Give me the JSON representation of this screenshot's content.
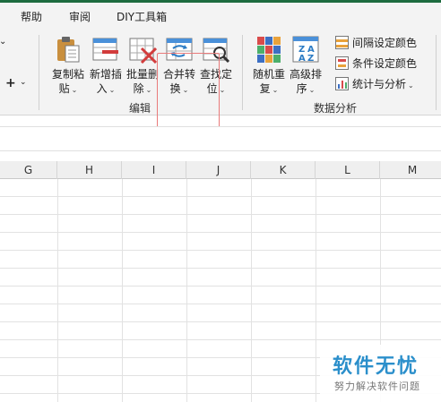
{
  "tabs": {
    "help": "帮助",
    "review": "审阅",
    "diy": "DIY工具箱"
  },
  "ribbon": {
    "left_edge_caret": "⌄",
    "left_plus": "+",
    "buttons": {
      "copy_paste": {
        "line1": "复制粘",
        "line2": "贴"
      },
      "new_insert": {
        "line1": "新增插",
        "line2": "入"
      },
      "batch_delete": {
        "line1": "批量删",
        "line2": "除"
      },
      "merge_convert": {
        "line1": "合并转",
        "line2": "换"
      },
      "find_locate": {
        "line1": "查找定",
        "line2": "位"
      },
      "random_shuffle": {
        "line1": "随机重",
        "line2": "复"
      },
      "advanced_sort": {
        "line1": "高级排",
        "line2": "序"
      }
    },
    "small_items": {
      "interval_color": "间隔设定颜色",
      "condition_color": "条件设定颜色",
      "stats_analysis": "统计与分析"
    },
    "groups": {
      "edit": "编辑",
      "data_analysis": "数据分析"
    }
  },
  "grid": {
    "columns": [
      "G",
      "H",
      "I",
      "J",
      "K",
      "L",
      "M"
    ]
  },
  "watermark": {
    "title": "软件无忧",
    "subtitle": "努力解决软件问题"
  },
  "colors": {
    "accent_green": "#1d6b3f",
    "highlight_red": "#e97a7a",
    "watermark_blue": "#2b8fcb"
  }
}
